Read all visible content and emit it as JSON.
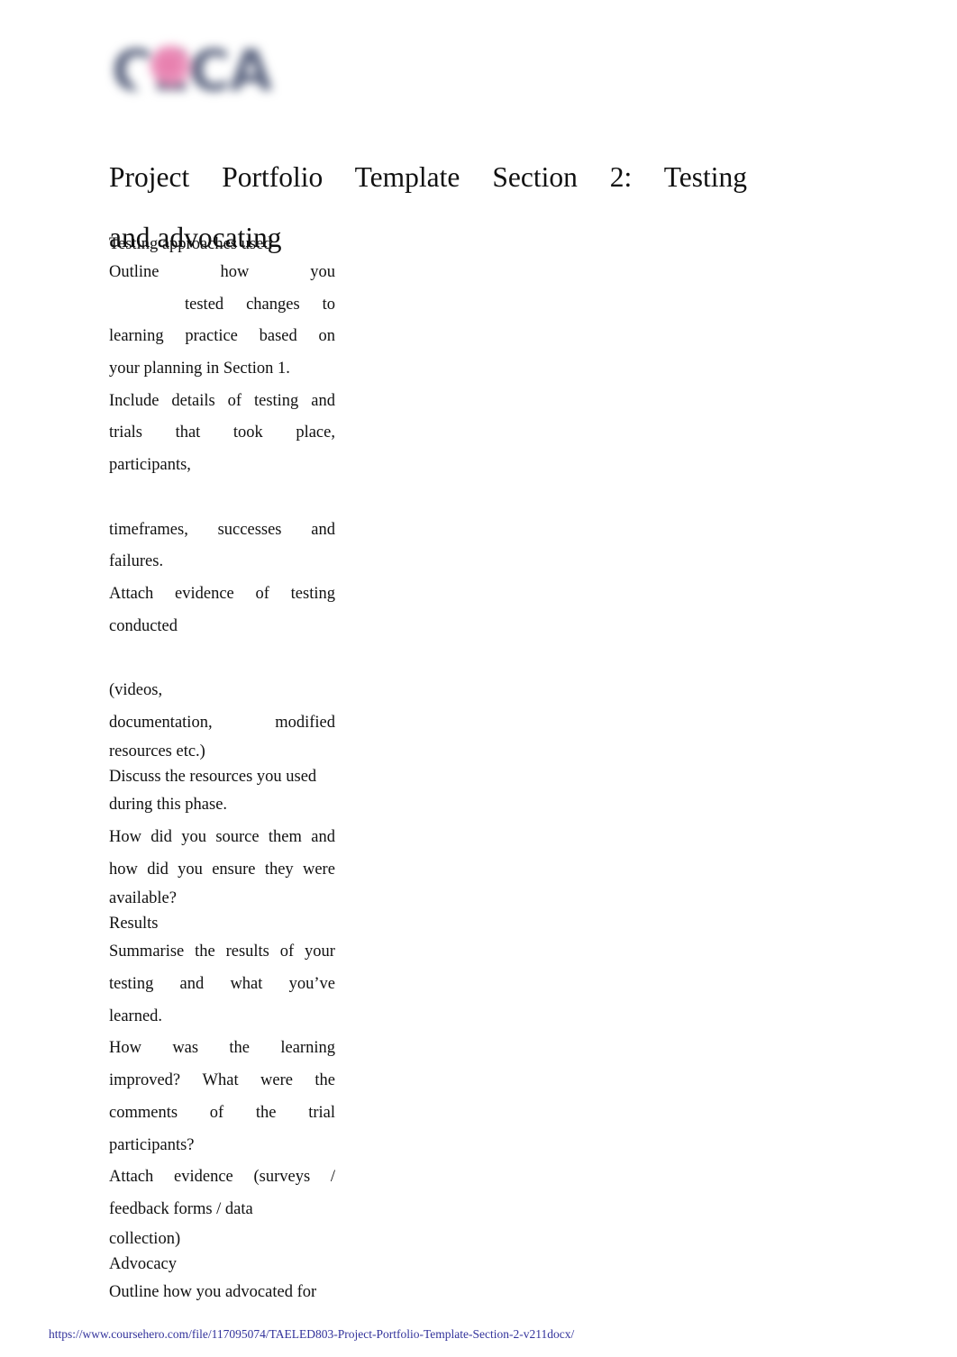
{
  "document": {
    "title_lines": [
      "Project Portfolio Template Section 2: Testing",
      "and advocating"
    ],
    "title_full": "Project Portfolio Template Section 2: Testing and advocating"
  },
  "logo": {
    "wordmark": "CECA",
    "icon_name": "ceca-logo",
    "text_color": "#5c6580",
    "accent_color": "#e678a8"
  },
  "body": {
    "lines": [
      {
        "id": "l1",
        "text": "Testing approaches used",
        "align": "left",
        "style": "tight"
      },
      {
        "id": "l2",
        "words": [
          "Outline",
          "how",
          "you"
        ],
        "align": "justify",
        "style": "normal"
      },
      {
        "id": "l3",
        "words": [
          "tested",
          "changes",
          "to"
        ],
        "align": "justify",
        "style": "indent"
      },
      {
        "id": "l4",
        "words": [
          "learning",
          "practice",
          "based",
          "on"
        ],
        "align": "justify",
        "style": "normal"
      },
      {
        "id": "l5",
        "text": "your planning in Section 1.",
        "align": "left",
        "style": "normal"
      },
      {
        "id": "l6",
        "words": [
          "Include",
          "details",
          "of",
          "testing",
          "and"
        ],
        "align": "justify",
        "style": "normal"
      },
      {
        "id": "l7",
        "words": [
          "trials",
          "that",
          "took",
          "place,"
        ],
        "align": "justify",
        "style": "normal"
      },
      {
        "id": "l8",
        "text": "participants,",
        "align": "left",
        "style": "normal"
      },
      {
        "id": "l9",
        "text": "",
        "align": "left",
        "style": "blank"
      },
      {
        "id": "l10",
        "words": [
          "timeframes,",
          "successes",
          "and"
        ],
        "align": "justify",
        "style": "normal"
      },
      {
        "id": "l11",
        "text": "failures.",
        "align": "left",
        "style": "normal"
      },
      {
        "id": "l12",
        "words": [
          "Attach",
          "evidence",
          "of",
          "testing"
        ],
        "align": "justify",
        "style": "normal"
      },
      {
        "id": "l13",
        "text": "conducted",
        "align": "left",
        "style": "normal"
      },
      {
        "id": "l14",
        "text": "",
        "align": "left",
        "style": "blank"
      },
      {
        "id": "l15",
        "text": "(videos,",
        "align": "left",
        "style": "normal"
      },
      {
        "id": "l16",
        "words": [
          "documentation,",
          "modified"
        ],
        "align": "justify",
        "style": "normal"
      },
      {
        "id": "l17",
        "text": "resources etc.)",
        "align": "left",
        "style": "tight"
      },
      {
        "id": "l18",
        "text": "Discuss the resources you used",
        "align": "left",
        "style": "tight"
      },
      {
        "id": "l19",
        "text": "during this phase.",
        "align": "left",
        "style": "normal"
      },
      {
        "id": "l20",
        "words": [
          "How",
          "did",
          "you",
          "source",
          "them",
          "and"
        ],
        "align": "justify",
        "style": "normal"
      },
      {
        "id": "l21",
        "words": [
          "how",
          "did",
          "you",
          "ensure",
          "they",
          "were"
        ],
        "align": "justify",
        "style": "normal"
      },
      {
        "id": "l22",
        "text": "available?",
        "align": "left",
        "style": "tight"
      },
      {
        "id": "l23",
        "text": "Results",
        "align": "left",
        "style": "tight"
      },
      {
        "id": "l24",
        "words": [
          "Summarise",
          "the",
          "results",
          "of",
          "your"
        ],
        "align": "justify",
        "style": "normal"
      },
      {
        "id": "l25",
        "words": [
          "testing",
          "and",
          "what",
          "you’ve"
        ],
        "align": "justify",
        "style": "normal"
      },
      {
        "id": "l26",
        "text": "learned.",
        "align": "left",
        "style": "normal"
      },
      {
        "id": "l27",
        "words": [
          "How",
          "was",
          "the",
          "learning"
        ],
        "align": "justify",
        "style": "normal"
      },
      {
        "id": "l28",
        "words": [
          "improved?",
          "What",
          "were",
          "the"
        ],
        "align": "justify",
        "style": "normal"
      },
      {
        "id": "l29",
        "words": [
          "comments",
          "of",
          "the",
          "trial"
        ],
        "align": "justify",
        "style": "normal"
      },
      {
        "id": "l30",
        "text": "participants?",
        "align": "left",
        "style": "normal"
      },
      {
        "id": "l31",
        "words": [
          "Attach",
          "evidence",
          "(surveys",
          "/"
        ],
        "align": "justify",
        "style": "normal"
      },
      {
        "id": "l32",
        "text": "feedback forms / data",
        "align": "left",
        "style": "normal"
      },
      {
        "id": "l33",
        "text": "collection)",
        "align": "left",
        "style": "tight"
      },
      {
        "id": "l34",
        "text": "Advocacy",
        "align": "left",
        "style": "tight"
      },
      {
        "id": "l35",
        "text": "Outline how you advocated for",
        "align": "left",
        "style": "normal"
      }
    ]
  },
  "footer": {
    "link_text": "https://www.coursehero.com/file/117095074/TAELED803-Project-Portfolio-Template-Section-2-v211docx/",
    "link_color": "#32329b"
  }
}
